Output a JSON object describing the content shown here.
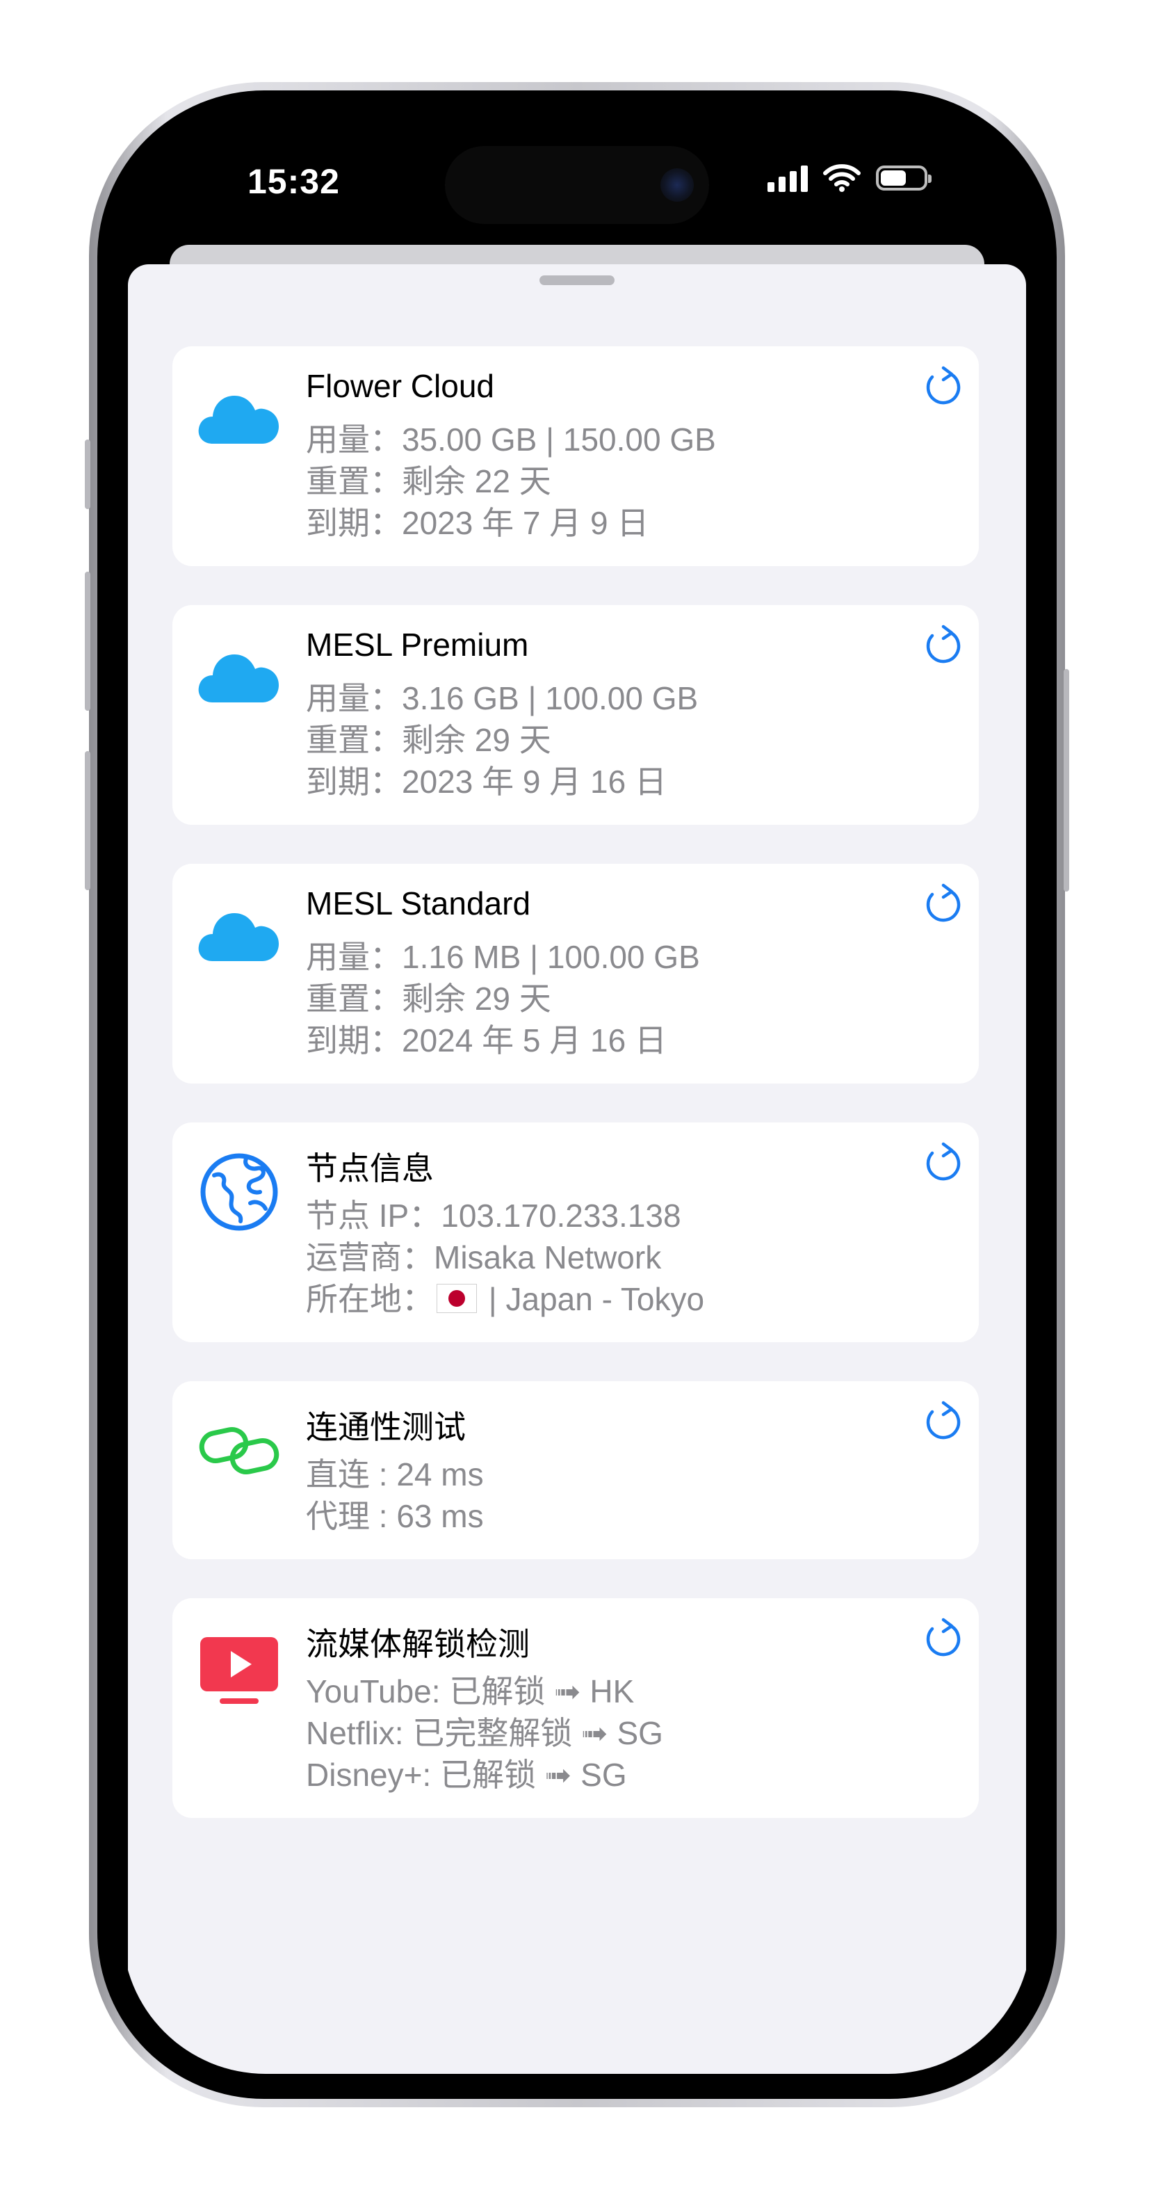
{
  "status_bar": {
    "time": "15:32"
  },
  "colors": {
    "accent": "#1a7cf2",
    "cloud": "#1fa9f1",
    "link_green": "#2ac94a",
    "media_red": "#f2384f",
    "secondary_text": "#8a8a8e"
  },
  "cards": [
    {
      "icon": "cloud-icon",
      "title": "Flower Cloud",
      "lines": [
        "用量：35.00 GB | 150.00 GB",
        "重置：剩余 22 天",
        "到期：2023 年 7 月 9 日"
      ]
    },
    {
      "icon": "cloud-icon",
      "title": "MESL Premium",
      "lines": [
        "用量：3.16 GB | 100.00 GB",
        "重置：剩余 29 天",
        "到期：2023 年 9 月 16 日"
      ]
    },
    {
      "icon": "cloud-icon",
      "title": "MESL Standard",
      "lines": [
        "用量：1.16 MB | 100.00 GB",
        "重置：剩余 29 天",
        "到期：2024 年 5 月 16 日"
      ]
    },
    {
      "icon": "globe-icon",
      "title": "节点信息",
      "lines": [
        "节点 IP：103.170.233.138",
        "运营商：Misaka Network"
      ],
      "location_label": "所在地：",
      "location_value": "| Japan - Tokyo"
    },
    {
      "icon": "link-icon",
      "title": "连通性测试",
      "lines": [
        "直连 : 24 ms",
        "代理 : 63 ms"
      ]
    },
    {
      "icon": "tv-play-icon",
      "title": "流媒体解锁检测",
      "lines": [
        "YouTube: 已解锁 ➟ HK",
        "Netflix: 已完整解锁 ➟ SG",
        "Disney+: 已解锁 ➟ SG"
      ]
    }
  ]
}
